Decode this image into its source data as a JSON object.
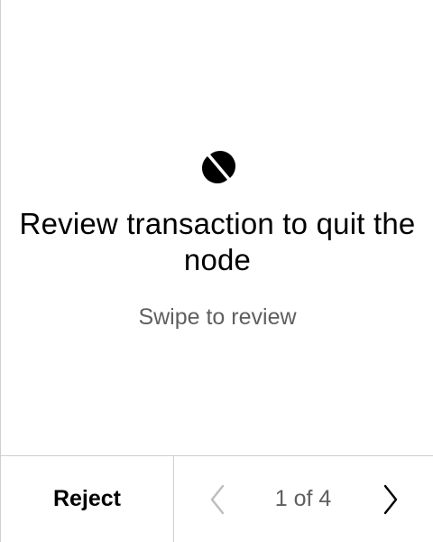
{
  "screen": {
    "title": "Review transaction to quit the node",
    "subtitle": "Swipe to review",
    "logo_icon": "ontology-logo-icon"
  },
  "footer": {
    "reject_label": "Reject",
    "page_indicator": "1 of 4",
    "prev_icon": "chevron-left-icon",
    "next_icon": "chevron-right-icon",
    "prev_enabled": false,
    "next_enabled": true
  },
  "colors": {
    "text_primary": "#000000",
    "text_secondary": "#5f5f5f",
    "chevron_disabled": "#bdbdbd",
    "divider": "#cfcfcf"
  }
}
